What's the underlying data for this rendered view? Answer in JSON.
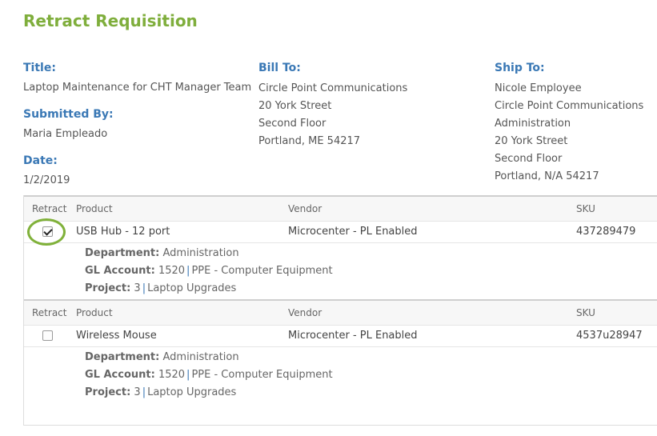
{
  "page_title": "Retract Requisition",
  "summary": {
    "title_label": "Title:",
    "title_value": "Laptop Maintenance for CHT Manager Team",
    "submitted_label": "Submitted By:",
    "submitted_value": "Maria Empleado",
    "date_label": "Date:",
    "date_value": "1/2/2019",
    "bill_label": "Bill To:",
    "bill_lines": [
      "Circle Point Communications",
      "20 York Street",
      "Second Floor",
      "Portland, ME 54217"
    ],
    "ship_label": "Ship To:",
    "ship_lines": [
      "Nicole Employee",
      "Circle Point Communications",
      "Administration",
      "20 York Street",
      "Second Floor",
      "Portland, N/A 54217"
    ]
  },
  "table": {
    "headers": {
      "retract": "Retract",
      "product": "Product",
      "vendor": "Vendor",
      "sku": "SKU"
    },
    "items": [
      {
        "checked": true,
        "product": "USB Hub - 12 port",
        "vendor": "Microcenter - PL Enabled",
        "sku": "437289479",
        "department_label": "Department:",
        "department": "Administration",
        "gl_label": "GL Account:",
        "gl_code": "1520",
        "gl_sep": "|",
        "gl_name": "PPE - Computer Equipment",
        "project_label": "Project:",
        "project_code": "3",
        "project_sep": "|",
        "project_name": "Laptop Upgrades"
      },
      {
        "checked": false,
        "product": "Wireless Mouse",
        "vendor": "Microcenter - PL Enabled",
        "sku": "4537u28947",
        "department_label": "Department:",
        "department": "Administration",
        "gl_label": "GL Account:",
        "gl_code": "1520",
        "gl_sep": "|",
        "gl_name": "PPE - Computer Equipment",
        "project_label": "Project:",
        "project_code": "3",
        "project_sep": "|",
        "project_name": "Laptop Upgrades"
      }
    ]
  },
  "colors": {
    "title_green": "#7fae3c",
    "label_blue": "#3a78b5",
    "highlight_ring": "#80b13a"
  }
}
